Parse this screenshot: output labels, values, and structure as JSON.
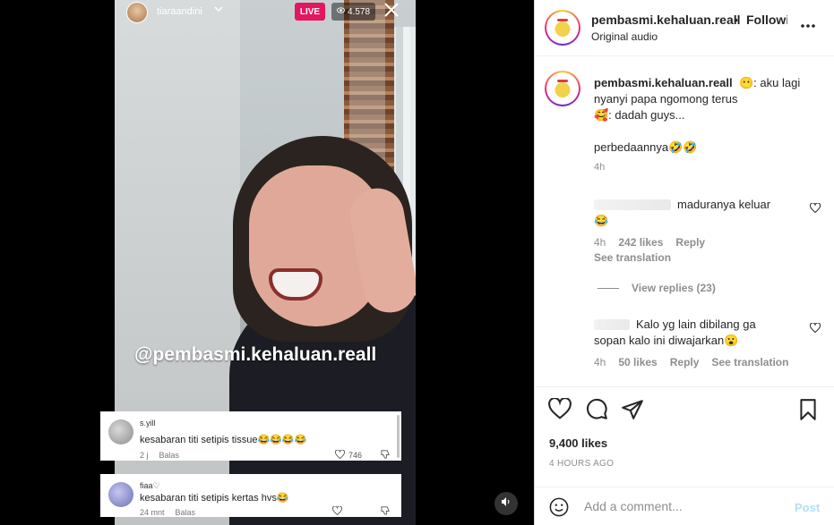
{
  "live": {
    "host": "tiaraandini",
    "badge": "LIVE",
    "viewers": "4.578",
    "watermark": "@pembasmi.kehaluan.reall",
    "comments": [
      {
        "user": "s.yill",
        "text": "kesabaran titi setipis tissue😂😂😂😂",
        "time": "2 j",
        "reply": "Balas",
        "likes": "746"
      },
      {
        "user": "fiaa♡",
        "text": "kesabaran titi setipis kertas hvs😂",
        "time": "24 mnt",
        "reply": "Balas",
        "likes": ""
      }
    ]
  },
  "header": {
    "username": "pembasmi.kehaluan.reall",
    "dot": "•",
    "follow": "Following",
    "audio": "Original audio"
  },
  "caption": {
    "username": "pembasmi.kehaluan.reall",
    "line1": "😶: aku lagi",
    "line2": "nyanyi papa ngomong terus",
    "line3": "🥰: dadah guys...",
    "line4": "perbedaannya🤣🤣",
    "time": "4h"
  },
  "comments": [
    {
      "text": "maduranya keluar",
      "text2": "😂",
      "time": "4h",
      "likes": "242 likes",
      "reply": "Reply",
      "translate": "See translation",
      "view_replies": "View replies (23)"
    },
    {
      "text": "Kalo yg lain dibilang ga",
      "text2": "sopan kalo ini diwajarkan😮",
      "time": "4h",
      "likes": "50 likes",
      "reply": "Reply",
      "translate": "See translation"
    }
  ],
  "post": {
    "likes": "9,400 likes",
    "posted": "4 HOURS AGO"
  },
  "composer": {
    "placeholder": "Add a comment...",
    "post_label": "Post"
  },
  "colors": {
    "live_badge": "#e3175f",
    "post_disabled": "#b2dffc"
  }
}
